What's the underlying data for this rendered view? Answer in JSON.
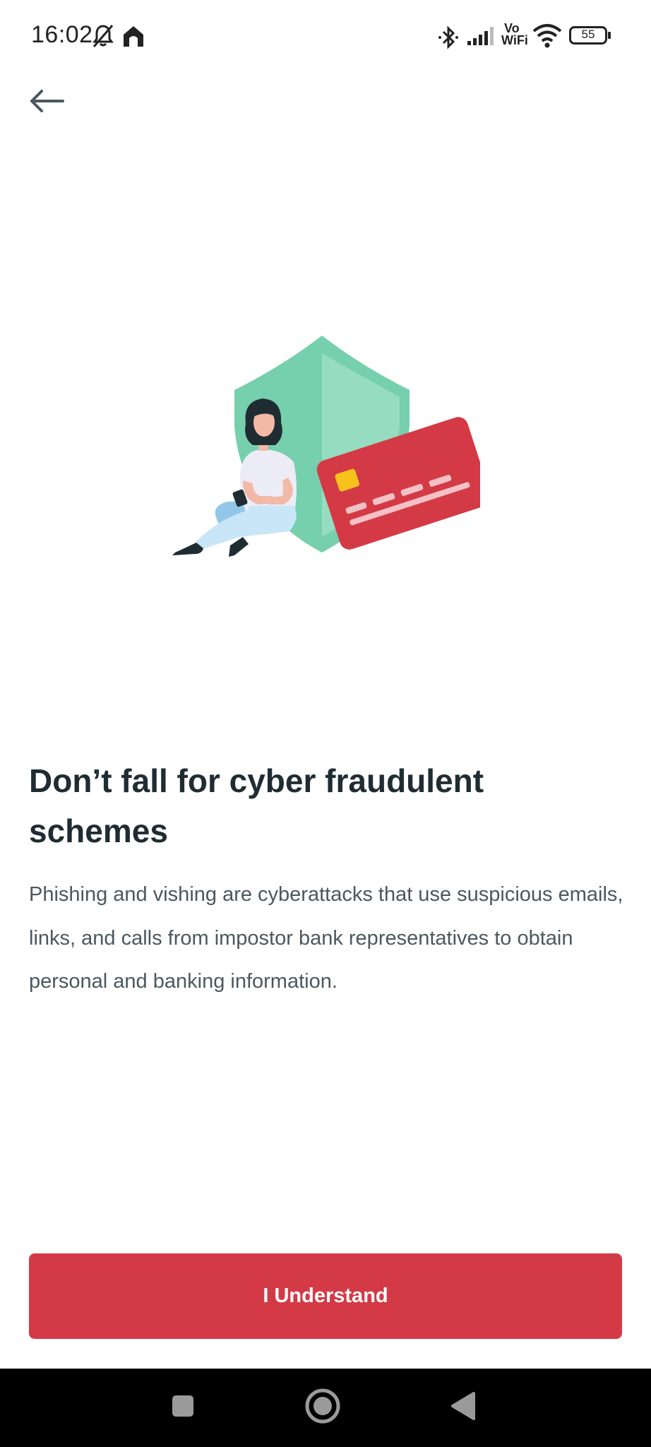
{
  "status_bar": {
    "time": "16:02",
    "battery_level": "55",
    "network_label_top": "Vo",
    "network_label_bottom": "WiFi",
    "icons": [
      "bell-off-icon",
      "home-icon",
      "bluetooth-icon",
      "signal-icon",
      "vowifi-icon",
      "wifi-icon",
      "battery-icon"
    ]
  },
  "header": {
    "back_icon": "arrow-left-icon"
  },
  "illustration": {
    "name": "woman-shield-credit-card-illustration",
    "colors": {
      "shield": "#76cfad",
      "shield_light": "#96dcc0",
      "card": "#d43a45",
      "card_chip": "#f6c21b",
      "shirt": "#ececf7",
      "pants": "#c9e6f9",
      "hair": "#1f2d33"
    }
  },
  "content": {
    "title": "Don’t fall for cyber fraudulent schemes",
    "description": "Phishing and vishing are cyberattacks that use suspicious emails, links, and calls from impostor bank representatives to obtain personal and banking information."
  },
  "actions": {
    "understand_label": "I Understand"
  },
  "nav_bar": {
    "items": [
      "recents-square-icon",
      "home-circle-icon",
      "back-triangle-icon"
    ]
  },
  "colors": {
    "accent": "#d43a45",
    "title_text": "#1f2d33",
    "body_text": "#4b585e",
    "nav_background": "#000000"
  }
}
